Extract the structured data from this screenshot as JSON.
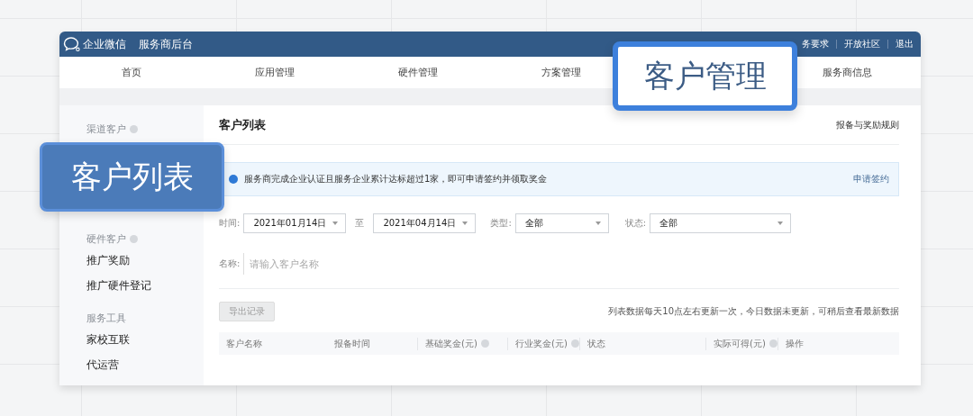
{
  "top_bar": {
    "brand": "企业微信",
    "subtitle": "服务商后台",
    "links": [
      "务要求",
      "开放社区",
      "退出"
    ]
  },
  "nav": [
    {
      "label": "首页",
      "selected": false
    },
    {
      "label": "应用管理",
      "selected": false
    },
    {
      "label": "硬件管理",
      "selected": false
    },
    {
      "label": "方案管理",
      "selected": false
    },
    {
      "label": "服务商信息",
      "selected": false
    }
  ],
  "sidebar": [
    {
      "kind": "heading",
      "label": "渠道客户",
      "info": true
    },
    {
      "kind": "heading",
      "label": "硬件客户",
      "info": true
    },
    {
      "kind": "link",
      "label": "推广奖励"
    },
    {
      "kind": "link",
      "label": "推广硬件登记"
    },
    {
      "kind": "heading",
      "label": "服务工具",
      "info": false
    },
    {
      "kind": "link",
      "label": "家校互联"
    },
    {
      "kind": "link",
      "label": "代运营"
    }
  ],
  "main": {
    "title": "客户列表",
    "rules_link": "报备与奖励规则",
    "notice": {
      "text": "服务商完成企业认证且服务企业累计达标超过1家，即可申请签约并领取奖金",
      "link": "申请签约"
    },
    "filters": [
      {
        "label": "时间:",
        "value": "2021年01月14日"
      },
      {
        "label": "至",
        "value": "2021年04月14日"
      },
      {
        "label": "类型:",
        "value": "全部"
      },
      {
        "label": "状态:",
        "value": "全部"
      }
    ],
    "name_field": {
      "label": "名称:",
      "placeholder": "请输入客户名称"
    },
    "export_button": {
      "label": "导出记录",
      "disabled": true
    },
    "update_note": "列表数据每天10点左右更新一次，今日数据未更新，可稍后查看最新数据",
    "table": {
      "columns": [
        {
          "label": "客户名称",
          "info": false
        },
        {
          "label": "报备时间",
          "info": false
        },
        {
          "label": "基础奖金(元)",
          "info": true
        },
        {
          "label": "行业奖金(元)",
          "info": true
        },
        {
          "label": "状态",
          "info": false
        },
        {
          "label": "实际可得(元)",
          "info": true
        },
        {
          "label": "操作",
          "info": false
        }
      ]
    }
  },
  "callouts": [
    {
      "kind": "outline",
      "text": "客户管理"
    },
    {
      "kind": "filled",
      "text": "客户列表"
    }
  ]
}
